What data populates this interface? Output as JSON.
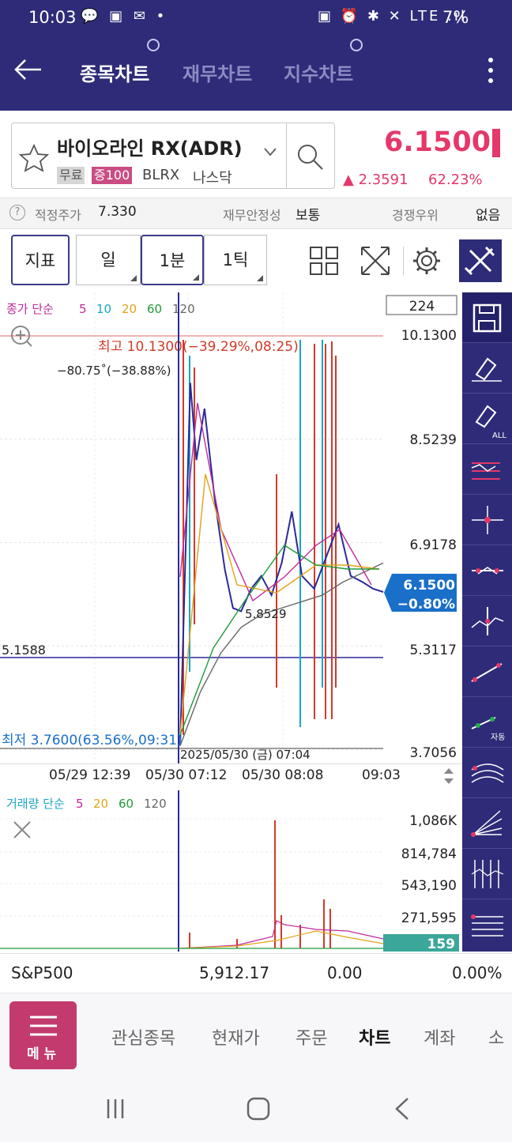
{
  "status": {
    "time": "10:03",
    "left_icons": "💬 ▣ ✉ •",
    "right_icons": "▣ ⏰ ✱ ✕ LTE .ıl",
    "battery": "7%"
  },
  "header": {
    "tabs": [
      {
        "label": "종목차트"
      },
      {
        "label": "재무차트"
      },
      {
        "label": "지수차트"
      }
    ]
  },
  "stock": {
    "name": "바이오라인 RX(ADR)",
    "badge1": "무료",
    "badge2": "증100",
    "ticker": "BLRX",
    "market": "나스닥",
    "price": "6.1500",
    "change": "▲ 2.3591",
    "change_pct": "62.23%"
  },
  "info": {
    "fair_label": "적정주가",
    "fair_value": "7.330",
    "stability_label": "재무안정성",
    "stability_value": "보통",
    "comp_label": "경쟁우위",
    "comp_value": "없음"
  },
  "toolbar": {
    "indicator": "지표",
    "day": "일",
    "minute": "1분",
    "tick": "1틱"
  },
  "chart": {
    "legend_prefix": "종가 단순",
    "ma": [
      {
        "label": "5",
        "color": "#c2299a"
      },
      {
        "label": "10",
        "color": "#1aa5c7"
      },
      {
        "label": "20",
        "color": "#e1a21a"
      },
      {
        "label": "60",
        "color": "#1f9a3c"
      },
      {
        "label": "120",
        "color": "#666666"
      }
    ],
    "count_box": "224",
    "high_label": "최고 10.1300(−39.29%,08:25)",
    "low_label": "최저 3.7600(63.56%,09:31)",
    "angle_label": "−80.75˚(−38.88%)",
    "point_label": "5.8529",
    "hline_label": "5.1588",
    "crosshair_label": "2025/05/30 (금) 07:04",
    "yticks": [
      "10.1300",
      "8.5239",
      "6.9178",
      "5.3117",
      "3.7056"
    ],
    "current_price": "6.1500",
    "current_pct": "−0.80%",
    "xticks": [
      "05/29 12:39",
      "05/30 07:12",
      "05/30 08:08",
      "09:03"
    ]
  },
  "volume": {
    "legend_prefix": "거래량 단순",
    "ma": [
      {
        "label": "5",
        "color": "#c2299a"
      },
      {
        "label": "20",
        "color": "#e1a21a"
      },
      {
        "label": "60",
        "color": "#1f9a3c"
      },
      {
        "label": "120",
        "color": "#666666"
      }
    ],
    "yticks": [
      "1,086K",
      "814,784",
      "543,190",
      "271,595"
    ],
    "current": "159"
  },
  "ticker": {
    "name": "S&P500",
    "value": "5,912.17",
    "change": "0.00",
    "pct": "0.00%"
  },
  "nav": {
    "menu": "메 뉴",
    "items": [
      {
        "label": "관심종목"
      },
      {
        "label": "현재가"
      },
      {
        "label": "주문"
      },
      {
        "label": "차트"
      },
      {
        "label": "계좌"
      },
      {
        "label": "소"
      }
    ]
  },
  "chart_data": {
    "type": "line",
    "ylim": [
      3.7056,
      10.13
    ],
    "series": [
      {
        "x": [
          0,
          0.05,
          0.08,
          0.12,
          0.17,
          0.22,
          0.26,
          0.3,
          0.35,
          0.4,
          0.45,
          0.5,
          0.55,
          0.6,
          0.66,
          0.72,
          0.78,
          0.84,
          0.9,
          0.95,
          1
        ],
        "values": [
          3.76,
          9.4,
          8.2,
          9.0,
          7.6,
          6.5,
          5.9,
          5.85,
          6.2,
          6.4,
          6.1,
          6.6,
          7.4,
          6.4,
          6.2,
          6.7,
          7.2,
          6.4,
          6.3,
          6.2,
          6.15
        ]
      },
      {
        "x": [
          0,
          0.1,
          0.2,
          0.3,
          0.4,
          0.5,
          0.6,
          0.7,
          0.8,
          0.9,
          1
        ],
        "values": [
          3.76,
          4.6,
          5.2,
          5.6,
          5.8,
          5.9,
          6.0,
          6.1,
          6.3,
          6.45,
          6.6
        ]
      }
    ],
    "volume_spike_x": [
      0.02,
      0.06,
      0.5,
      0.75,
      0.8
    ]
  }
}
